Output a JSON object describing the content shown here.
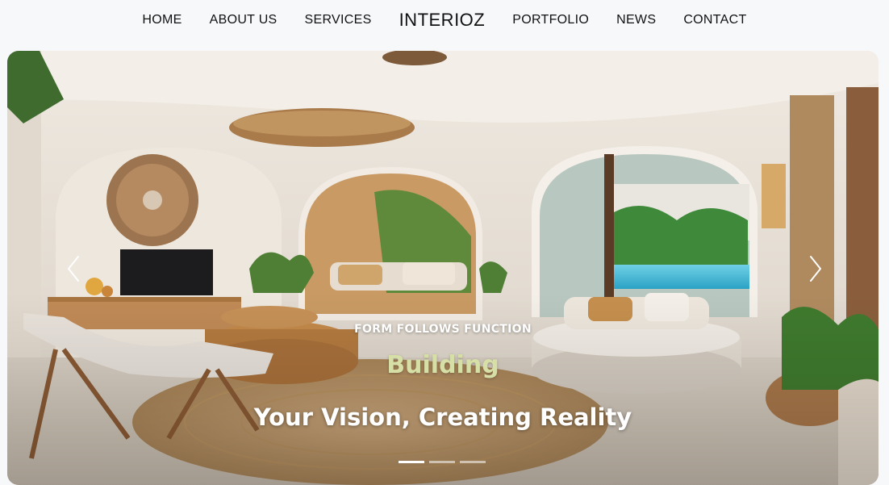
{
  "nav": {
    "items_left": [
      "HOME",
      "ABOUT US",
      "SERVICES"
    ],
    "brand": "INTERIOZ",
    "items_right": [
      "PORTFOLIO",
      "NEWS",
      "CONTACT"
    ]
  },
  "hero": {
    "eyebrow": "FORM FOLLOWS FUNCTION",
    "headline": "Building",
    "subline": "Your Vision, Creating Reality",
    "slides_total": 3,
    "active_slide": 1,
    "image_icon": "living-room-photo",
    "prev_icon": "chevron-left-icon",
    "next_icon": "chevron-right-icon"
  },
  "colors": {
    "headline": "#d6dfa6",
    "nav_bg": "#f7f8fa",
    "text": "#111111"
  }
}
